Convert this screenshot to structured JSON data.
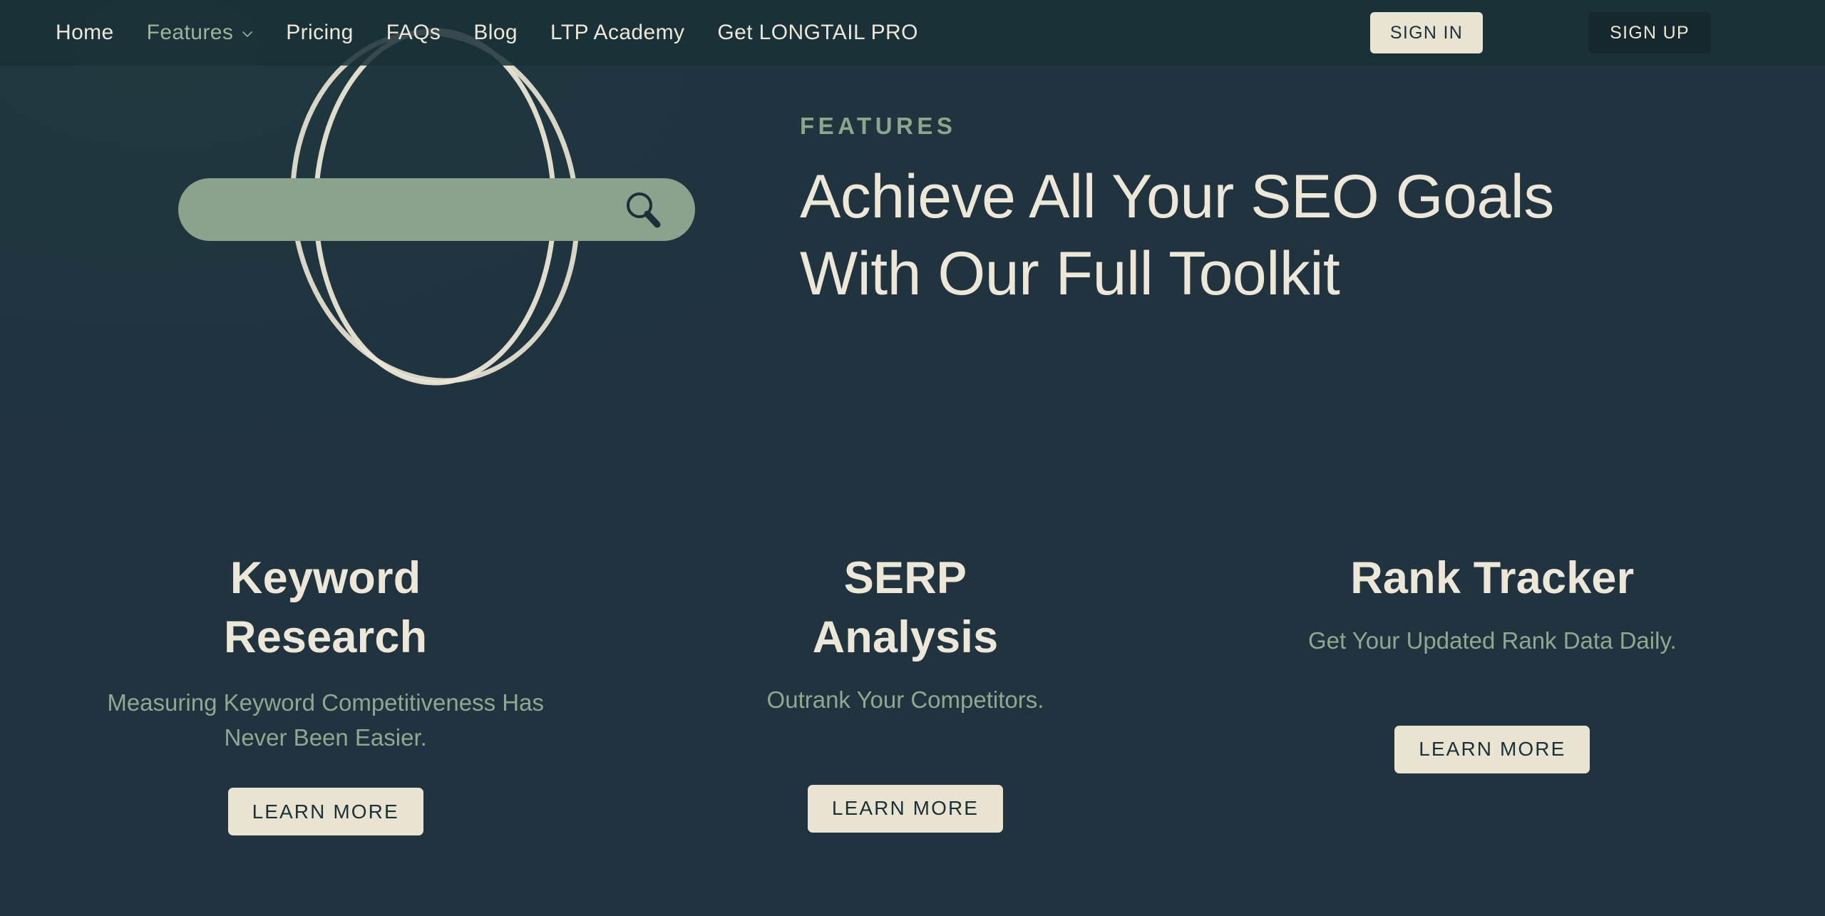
{
  "colors": {
    "background": "#20333F",
    "nav_overlay": "#1B3137",
    "cream": "#ECE7D8",
    "sage": "#8BA38D",
    "sage_text": "#8FA88F",
    "eyebrow": "#8AA68C",
    "dark_button": "#16282E",
    "dark_text": "#1C3038"
  },
  "nav": {
    "links": [
      {
        "label": "Home",
        "muted": false,
        "has_chevron": false
      },
      {
        "label": "Features",
        "muted": true,
        "has_chevron": true
      },
      {
        "label": "Pricing",
        "muted": false,
        "has_chevron": false
      },
      {
        "label": "FAQs",
        "muted": false,
        "has_chevron": false
      },
      {
        "label": "Blog",
        "muted": false,
        "has_chevron": false
      },
      {
        "label": "LTP Academy",
        "muted": false,
        "has_chevron": false
      },
      {
        "label": "Get LONGTAIL PRO",
        "muted": false,
        "has_chevron": false
      }
    ],
    "sign_in_label": "SIGN IN",
    "sign_up_label": "SIGN UP"
  },
  "hero": {
    "eyebrow": "FEATURES",
    "title_line_1": "Achieve All Your SEO Goals",
    "title_line_2": "With Our Full Toolkit",
    "illustration": {
      "search_icon": "search-icon",
      "ellipse_count": 2
    }
  },
  "features": [
    {
      "title": "Keyword Research",
      "description": "Measuring Keyword Competitiveness Has Never Been Easier.",
      "cta_label": "LEARN MORE"
    },
    {
      "title": "SERP Analysis",
      "description": "Outrank Your Competitors.",
      "cta_label": "LEARN MORE"
    },
    {
      "title": "Rank Tracker",
      "description": "Get Your Updated Rank Data Daily.",
      "cta_label": "LEARN MORE"
    }
  ]
}
